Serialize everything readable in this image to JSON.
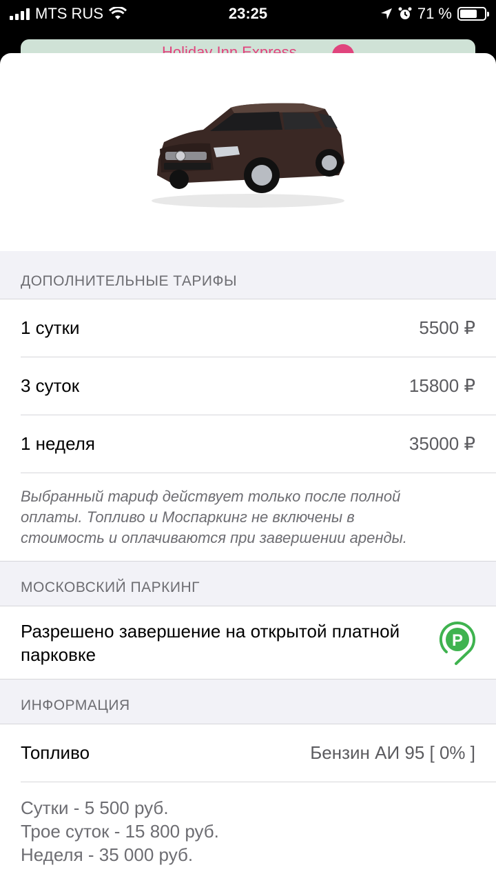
{
  "status_bar": {
    "carrier": "MTS RUS",
    "time": "23:25",
    "battery": "71 %",
    "battery_level": 0.71
  },
  "background_card": {
    "place": "Holiday Inn Express"
  },
  "tariffs": {
    "header": "ДОПОЛНИТЕЛЬНЫЕ ТАРИФЫ",
    "items": [
      {
        "label": "1 сутки",
        "price": "5500 ₽"
      },
      {
        "label": "3 суток",
        "price": "15800 ₽"
      },
      {
        "label": "1 неделя",
        "price": "35000 ₽"
      }
    ],
    "note": "Выбранный тариф действует только после полной оплаты. Топливо и Моспаркинг не включены в стоимость и оплачиваются при завершении аренды."
  },
  "parking": {
    "header": "МОСКОВСКИЙ ПАРКИНГ",
    "text": "Разрешено завершение на открытой платной парковке",
    "icon": "parking-pin-icon",
    "icon_color": "#3fb34f"
  },
  "info": {
    "header": "ИНФОРМАЦИЯ",
    "fuel_label": "Топливо",
    "fuel_value": "Бензин АИ 95 [ 0% ]",
    "lines": [
      "Сутки - 5 500 руб.",
      "Трое суток - 15 800 руб.",
      "Неделя - 35 000 руб."
    ]
  }
}
